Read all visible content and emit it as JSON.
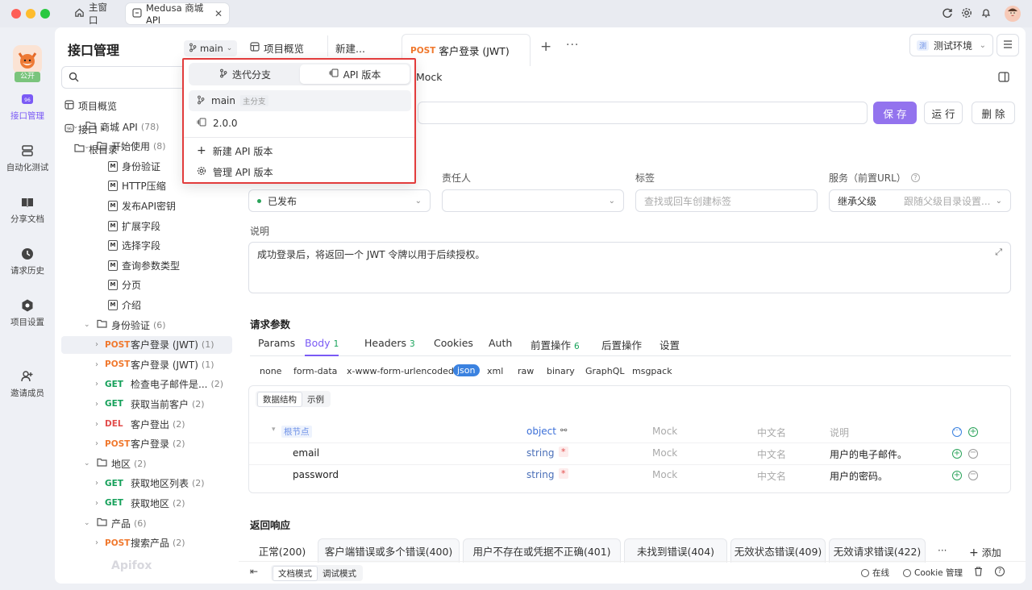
{
  "window": {
    "tabs": [
      {
        "label": "主窗口"
      },
      {
        "label": "Medusa 商城 API"
      }
    ],
    "avatar_initial": ""
  },
  "leftnav": {
    "badge": "公开",
    "items": [
      {
        "label": "接口管理",
        "icon": "api-icon",
        "active": true
      },
      {
        "label": "自动化测试",
        "icon": "automation-icon"
      },
      {
        "label": "分享文档",
        "icon": "book-icon"
      },
      {
        "label": "请求历史",
        "icon": "clock-icon"
      },
      {
        "label": "项目设置",
        "icon": "settings-icon"
      },
      {
        "label": "邀请成员",
        "icon": "add-user-icon"
      }
    ]
  },
  "panel": {
    "title": "接口管理",
    "branch": "main",
    "overview": "项目概览",
    "interface": "接口",
    "root": "根目录",
    "tree": [
      {
        "type": "folder",
        "label": "商城 API",
        "count": "(78)",
        "indent": 1
      },
      {
        "type": "folder",
        "label": "开始使用",
        "count": "(8)",
        "indent": 2
      },
      {
        "type": "doc",
        "label": "身份验证",
        "indent": 3
      },
      {
        "type": "doc",
        "label": "HTTP压缩",
        "indent": 3
      },
      {
        "type": "doc",
        "label": "发布API密钥",
        "indent": 3
      },
      {
        "type": "doc",
        "label": "扩展字段",
        "indent": 3
      },
      {
        "type": "doc",
        "label": "选择字段",
        "indent": 3
      },
      {
        "type": "doc",
        "label": "查询参数类型",
        "indent": 3
      },
      {
        "type": "doc",
        "label": "分页",
        "indent": 3
      },
      {
        "type": "doc",
        "label": "介绍",
        "indent": 3
      },
      {
        "type": "folder",
        "label": "身份验证",
        "count": "(6)",
        "indent": 2
      },
      {
        "type": "api",
        "method": "POST",
        "label": "客户登录 (JWT)",
        "count": "(1)",
        "indent": 3,
        "selected": true
      },
      {
        "type": "api",
        "method": "POST",
        "label": "客户登录 (JWT)",
        "count": "(1)",
        "indent": 3
      },
      {
        "type": "api",
        "method": "GET",
        "label": "检查电子邮件是...",
        "count": "(2)",
        "indent": 3
      },
      {
        "type": "api",
        "method": "GET",
        "label": "获取当前客户",
        "count": "(2)",
        "indent": 3
      },
      {
        "type": "api",
        "method": "DEL",
        "label": "客户登出",
        "count": "(2)",
        "indent": 3
      },
      {
        "type": "api",
        "method": "POST",
        "label": "客户登录",
        "count": "(2)",
        "indent": 3
      },
      {
        "type": "folder",
        "label": "地区",
        "count": "(2)",
        "indent": 2
      },
      {
        "type": "api",
        "method": "GET",
        "label": "获取地区列表",
        "count": "(2)",
        "indent": 3
      },
      {
        "type": "api",
        "method": "GET",
        "label": "获取地区",
        "count": "(2)",
        "indent": 3
      },
      {
        "type": "folder",
        "label": "产品",
        "count": "(6)",
        "indent": 2
      },
      {
        "type": "api",
        "method": "POST",
        "label": "搜索产品",
        "count": "(2)",
        "indent": 3
      }
    ],
    "watermark": "Apifox"
  },
  "popup": {
    "seg_branch": "迭代分支",
    "seg_version": "API 版本",
    "items": [
      {
        "label": "main",
        "tag": "主分支"
      },
      {
        "label": "2.0.0"
      }
    ],
    "new_version": "新建 API 版本",
    "manage_version": "管理 API 版本"
  },
  "main": {
    "tabs": [
      {
        "label": "项目概览"
      },
      {
        "label": "新建..."
      },
      {
        "method": "POST",
        "label": "客户登录 (JWT)",
        "active": true
      }
    ],
    "env": "测试环境",
    "env_badge": "测",
    "subtab_mock": "Mock",
    "buttons": {
      "save": "保 存",
      "run": "运 行",
      "delete": "删 除"
    },
    "fields": {
      "owner_label": "责任人",
      "tag_label": "标签",
      "service_label": "服务（前置URL）",
      "status": "已发布",
      "tag_placeholder": "查找或回车创建标签",
      "service_value": "继承父级",
      "service_hint": "跟随父级目录设置..."
    },
    "desc_label": "说明",
    "desc": "成功登录后，将返回一个 JWT 令牌以用于后续授权。",
    "req_title": "请求参数",
    "req_tabs": [
      {
        "label": "Params"
      },
      {
        "label": "Body",
        "badge": "1",
        "active": true
      },
      {
        "label": "Headers",
        "badge": "3"
      },
      {
        "label": "Cookies"
      },
      {
        "label": "Auth"
      },
      {
        "label": "前置操作",
        "badge": "6"
      },
      {
        "label": "后置操作"
      },
      {
        "label": "设置"
      }
    ],
    "body_types": [
      "none",
      "form-data",
      "x-www-form-urlencoded",
      "json",
      "xml",
      "raw",
      "binary",
      "GraphQL",
      "msgpack"
    ],
    "body_active": "json",
    "schema_tabs": [
      "数据结构",
      "示例"
    ],
    "schema_rows": [
      {
        "name": "根节点",
        "type": "object",
        "mock": "Mock",
        "cn": "中文名",
        "desc": "说明",
        "root": true
      },
      {
        "name": "email",
        "type": "string",
        "mock": "Mock",
        "cn": "中文名",
        "desc": "用户的电子邮件。",
        "required": "*"
      },
      {
        "name": "password",
        "type": "string",
        "mock": "Mock",
        "cn": "中文名",
        "desc": "用户的密码。",
        "required": "*"
      }
    ],
    "resp_title": "返回响应",
    "resp_tabs": [
      {
        "label": "正常(200)",
        "active": true
      },
      {
        "label": "客户端错误或多个错误(400)"
      },
      {
        "label": "用户不存在或凭据不正确(401)"
      },
      {
        "label": "未找到错误(404)"
      },
      {
        "label": "无效状态错误(409)"
      },
      {
        "label": "无效请求错误(422)"
      }
    ],
    "resp_more": "···",
    "resp_add": "添加"
  },
  "statusbar": {
    "doc_mode": "文档模式",
    "debug_mode": "调试模式",
    "online": "在线",
    "cookie": "Cookie 管理"
  },
  "colors": {
    "accent": "#9373ee",
    "post": "#f0782d",
    "get": "#15a05a",
    "del": "#e24c4b",
    "highlight": "#e23c3c"
  }
}
